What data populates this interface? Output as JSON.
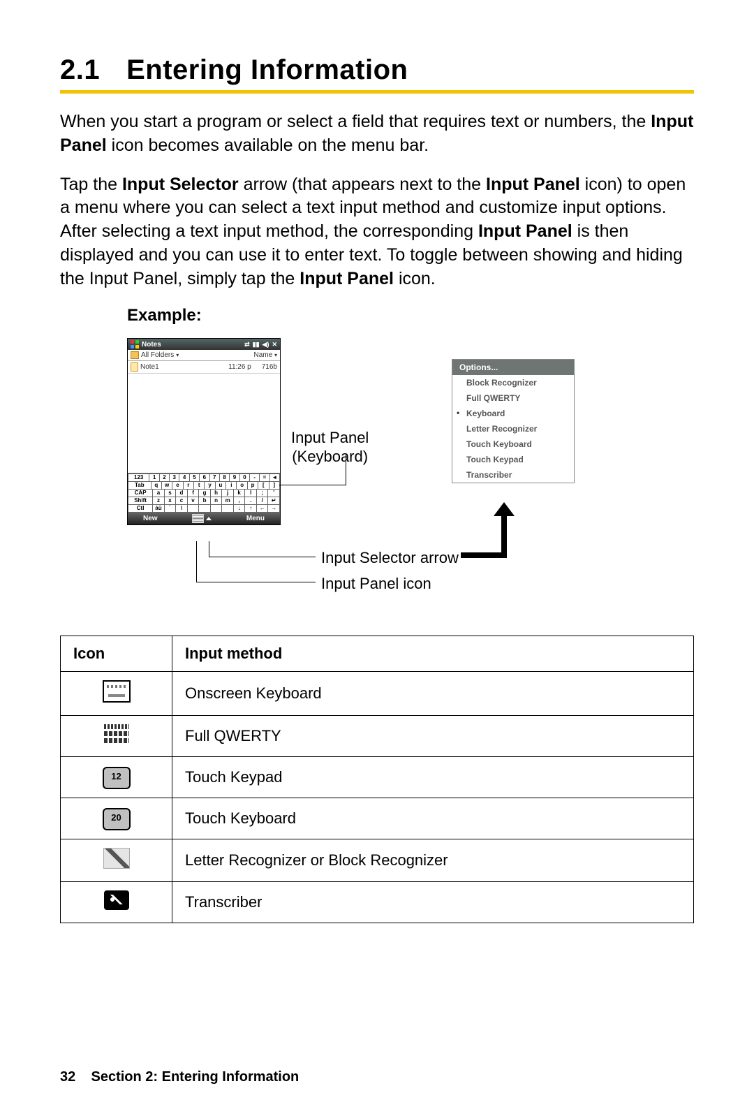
{
  "heading": {
    "number": "2.1",
    "title": "Entering Information"
  },
  "para1": {
    "pre": "When you start a program or select a field that requires text or numbers, the ",
    "b1": "Input Panel",
    "post": " icon becomes available on the menu bar."
  },
  "para2": {
    "s1": "Tap the ",
    "b1": "Input Selector",
    "s2": " arrow (that appears next to the ",
    "b2": "Input Panel",
    "s3": " icon) to open a menu where you can select a text input method and customize input options. After selecting a text input method, the corresponding ",
    "b3": "Input Panel",
    "s4": " is then displayed and you can use it to enter text. To toggle between showing and hiding the Input Panel, simply tap the ",
    "b4": "Input Panel",
    "s5": " icon."
  },
  "example_label": "Example:",
  "phone": {
    "title": "Notes",
    "folders_label": "All Folders",
    "name_col": "Name",
    "note": {
      "name": "Note1",
      "time": "11:26 p",
      "size": "716b"
    },
    "kbd_rows": [
      [
        "123",
        "1",
        "2",
        "3",
        "4",
        "5",
        "6",
        "7",
        "8",
        "9",
        "0",
        "-",
        "=",
        "◄"
      ],
      [
        "Tab",
        "q",
        "w",
        "e",
        "r",
        "t",
        "y",
        "u",
        "i",
        "o",
        "p",
        "[",
        "]"
      ],
      [
        "CAP",
        "a",
        "s",
        "d",
        "f",
        "g",
        "h",
        "j",
        "k",
        "l",
        ";",
        "'"
      ],
      [
        "Shift",
        "z",
        "x",
        "c",
        "v",
        "b",
        "n",
        "m",
        ",",
        ".",
        "/",
        "↵"
      ],
      [
        "Ctl",
        "áü",
        "`",
        "\\",
        "",
        "",
        "",
        "",
        "↓",
        "↑",
        "←",
        "→"
      ]
    ],
    "new_btn": "New",
    "menu_btn": "Menu"
  },
  "options": {
    "title": "Options...",
    "items": [
      "Block Recognizer",
      "Full QWERTY",
      "Keyboard",
      "Letter Recognizer",
      "Touch Keyboard",
      "Touch Keypad",
      "Transcriber"
    ],
    "selected_index": 2
  },
  "callouts": {
    "keyboard_l1": "Input Panel",
    "keyboard_l2": "(Keyboard)",
    "selector": "Input Selector arrow",
    "panel_icon": "Input Panel icon"
  },
  "table": {
    "head_icon": "Icon",
    "head_method": "Input method",
    "rows": [
      {
        "icon": "kbd-out",
        "icon_text": "",
        "label": "Onscreen Keyboard"
      },
      {
        "icon": "kbd-full",
        "icon_text": "",
        "label": "Full QWERTY"
      },
      {
        "icon": "keypad",
        "icon_text": "12",
        "label": "Touch Keypad"
      },
      {
        "icon": "keypad",
        "icon_text": "20",
        "label": "Touch Keyboard"
      },
      {
        "icon": "pen",
        "icon_text": "",
        "label": "Letter Recognizer or Block Recognizer"
      },
      {
        "icon": "transcriber",
        "icon_text": "",
        "label": "Transcriber"
      }
    ]
  },
  "footer": {
    "page": "32",
    "text": "Section 2: Entering Information"
  }
}
